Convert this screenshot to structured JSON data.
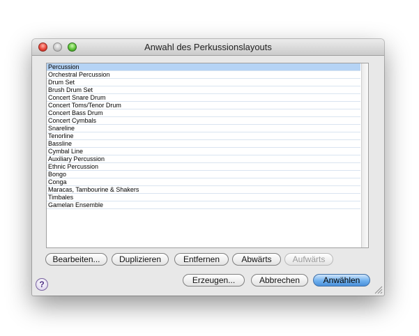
{
  "window": {
    "title": "Anwahl des Perkussionslayouts"
  },
  "list": {
    "selected_index": 0,
    "items": [
      "Percussion",
      "Orchestral Percussion",
      "Drum Set",
      "Brush Drum Set",
      "Concert Snare Drum",
      "Concert Toms/Tenor Drum",
      "Concert Bass Drum",
      "Concert Cymbals",
      "Snareline",
      "Tenorline",
      "Bassline",
      "Cymbal Line",
      "Auxiliary Percussion",
      "Ethnic Percussion",
      "Bongo",
      "Conga",
      "Maracas, Tambourine & Shakers",
      "Timbales",
      "Gamelan Ensemble"
    ]
  },
  "buttons": {
    "edit": "Bearbeiten...",
    "duplicate": "Duplizieren",
    "remove": "Entfernen",
    "down": "Abwärts",
    "up": "Aufwärts",
    "create": "Erzeugen...",
    "cancel": "Abbrechen",
    "select": "Anwählen"
  },
  "help": {
    "glyph": "?"
  },
  "colors": {
    "selection": "#b5d3f5",
    "default_button": "#6fb0ee",
    "row_separator": "#d9e4f0"
  }
}
